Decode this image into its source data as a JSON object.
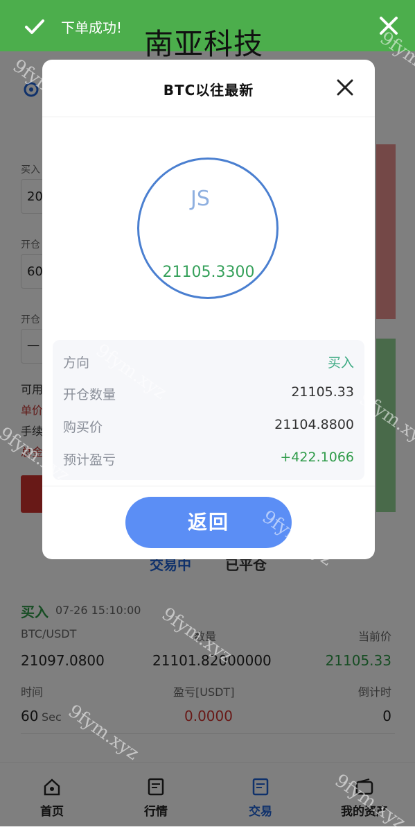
{
  "toast": {
    "message": "下单成功!"
  },
  "brand_overlay": "南亚科技",
  "background": {
    "labels": {
      "buy": "买入",
      "open1": "开仓",
      "open2": "开仓"
    },
    "fields": {
      "f1": "20",
      "f2": "60",
      "f3": "一"
    },
    "side_texts": {
      "avail": "可用",
      "unit": "单价",
      "fee": "手续",
      "total": "总金"
    },
    "tabs": {
      "active": "交易中",
      "closed": "已平仓"
    },
    "trade": {
      "direction": "买入",
      "time": "07-26 15:10:00",
      "h_pair": "BTC/USDT",
      "h_qty": "数量",
      "h_cur": "当前价",
      "v_open": "21097.0800",
      "v_qty": "21101.82000000",
      "v_cur": "21105.33",
      "h_time": "时间",
      "h_pnl": "盈亏[USDT]",
      "h_countdown": "倒计时",
      "v_time": "60",
      "v_time_unit": "Sec",
      "v_pnl": "0.0000",
      "v_countdown": "0"
    },
    "nav": [
      {
        "label": "首页",
        "icon": "home-icon"
      },
      {
        "label": "行情",
        "icon": "market-icon"
      },
      {
        "label": "交易",
        "icon": "trade-icon"
      },
      {
        "label": "我的资产",
        "icon": "wallet-icon"
      }
    ]
  },
  "modal": {
    "title": "BTC以往最新",
    "ring_text": "JS",
    "price": "21105.3300",
    "rows": [
      {
        "key": "方向",
        "value": "买入"
      },
      {
        "key": "开仓数量",
        "value": "21105.33"
      },
      {
        "key": "购买价",
        "value": "21104.8800"
      },
      {
        "key": "预计盈亏",
        "value": "+422.1066"
      }
    ],
    "back_label": "返回"
  },
  "watermark": "9fym.xyz",
  "colors": {
    "success": "#4cae4c",
    "accent": "#5b8ef5",
    "up": "#2f9b49",
    "down": "#d0322f"
  }
}
